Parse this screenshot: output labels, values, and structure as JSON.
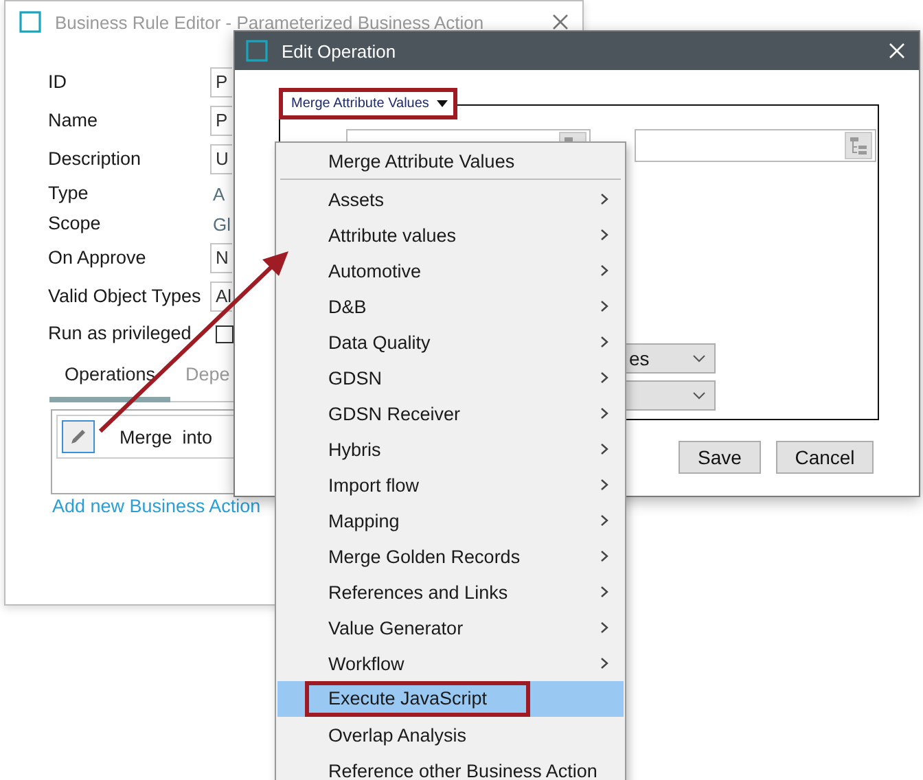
{
  "back_window": {
    "title": "Business Rule Editor - Parameterized Business Action",
    "fields": [
      {
        "label": "ID",
        "value": "P",
        "kind": "field"
      },
      {
        "label": "Name",
        "value": "P",
        "kind": "field"
      },
      {
        "label": "Description",
        "value": "U",
        "kind": "field"
      },
      {
        "label": "Type",
        "value": "A",
        "kind": "text"
      },
      {
        "label": "Scope",
        "value": "Gl",
        "kind": "text"
      },
      {
        "label": "On Approve",
        "value": "N",
        "kind": "field"
      },
      {
        "label": "Valid Object Types",
        "value": "Al",
        "kind": "field"
      },
      {
        "label": "Run as privileged",
        "checked": false,
        "kind": "checkbox"
      }
    ],
    "tabs": [
      {
        "label": "Operations",
        "selected": true
      },
      {
        "label": "Depe",
        "selected": false
      }
    ],
    "operations": [
      {
        "text": "Merge  into"
      }
    ],
    "link": "Add new Business Action"
  },
  "edit_window": {
    "title": "Edit Operation",
    "group_legend": "Merge Attribute Values",
    "selects": [
      {
        "kind": "text",
        "value": "es"
      },
      {
        "kind": "blank"
      }
    ],
    "buttons": [
      "Save",
      "Cancel"
    ]
  },
  "menu": {
    "items": [
      {
        "kind": "action",
        "label": "Merge Attribute Values",
        "selected": false,
        "outlined": false
      },
      {
        "kind": "separator"
      },
      {
        "kind": "submenu",
        "label": "Assets",
        "selected": false,
        "outlined": false
      },
      {
        "kind": "submenu",
        "label": "Attribute values",
        "selected": false,
        "outlined": false
      },
      {
        "kind": "submenu",
        "label": "Automotive",
        "selected": false,
        "outlined": false
      },
      {
        "kind": "submenu",
        "label": "D&B",
        "selected": false,
        "outlined": false
      },
      {
        "kind": "submenu",
        "label": "Data Quality",
        "selected": false,
        "outlined": false
      },
      {
        "kind": "submenu",
        "label": "GDSN",
        "selected": false,
        "outlined": false
      },
      {
        "kind": "submenu",
        "label": "GDSN Receiver",
        "selected": false,
        "outlined": false
      },
      {
        "kind": "submenu",
        "label": "Hybris",
        "selected": false,
        "outlined": false
      },
      {
        "kind": "submenu",
        "label": "Import flow",
        "selected": false,
        "outlined": false
      },
      {
        "kind": "submenu",
        "label": "Mapping",
        "selected": false,
        "outlined": false
      },
      {
        "kind": "submenu",
        "label": "Merge Golden Records",
        "selected": false,
        "outlined": false
      },
      {
        "kind": "submenu",
        "label": "References and Links",
        "selected": false,
        "outlined": false
      },
      {
        "kind": "submenu",
        "label": "Value Generator",
        "selected": false,
        "outlined": false
      },
      {
        "kind": "submenu",
        "label": "Workflow",
        "selected": false,
        "outlined": false
      },
      {
        "kind": "action",
        "label": "Execute JavaScript",
        "selected": true,
        "outlined": true
      },
      {
        "kind": "action",
        "label": "Overlap Analysis",
        "selected": false,
        "outlined": false
      },
      {
        "kind": "action",
        "label": "Reference other Business Action",
        "selected": false,
        "outlined": false
      }
    ]
  }
}
